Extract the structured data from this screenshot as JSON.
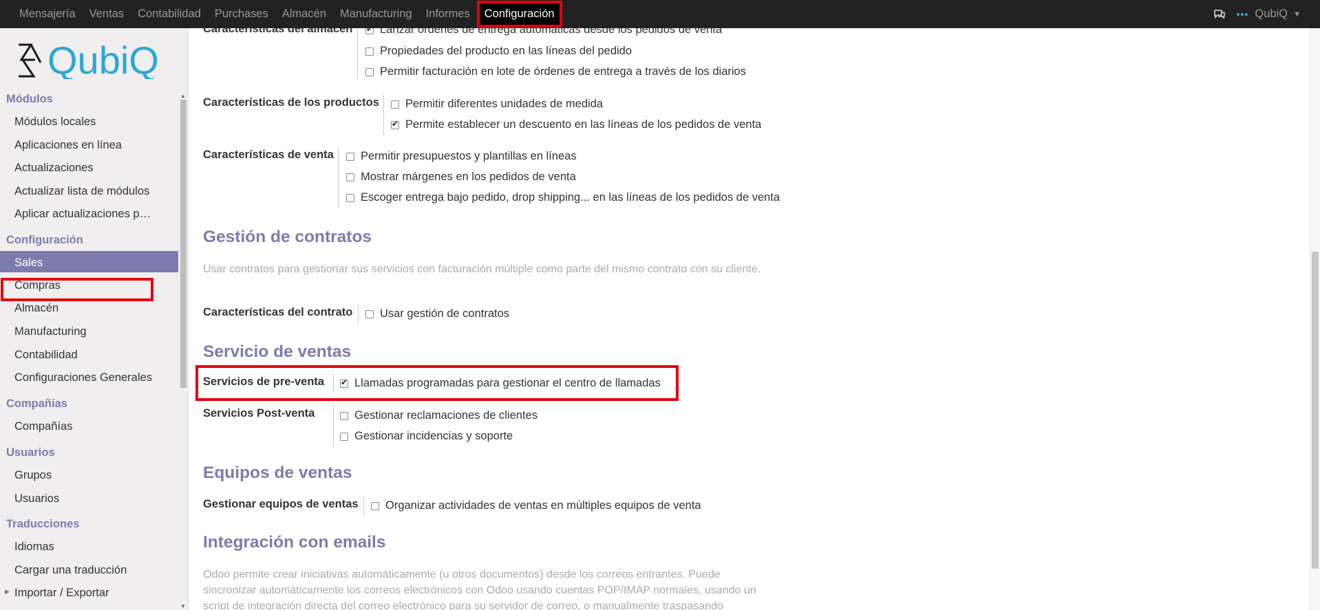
{
  "topbar": {
    "menu": [
      "Mensajería",
      "Ventas",
      "Contabilidad",
      "Purchases",
      "Almacén",
      "Manufacturing",
      "Informes",
      "Configuración"
    ],
    "active": "Configuración",
    "user": "QubiQ"
  },
  "sidebar": {
    "logo_text": "QubiQ",
    "sections": [
      {
        "title": "Módulos",
        "items": [
          "Módulos locales",
          "Aplicaciones en línea",
          "Actualizaciones",
          "Actualizar lista de módulos",
          "Aplicar actualizaciones p…"
        ]
      },
      {
        "title": "Configuración",
        "items": [
          "Sales",
          "Compras",
          "Almacén",
          "Manufacturing",
          "Contabilidad",
          "Configuraciones Generales"
        ]
      },
      {
        "title": "Compañías",
        "items": [
          "Compañías"
        ]
      },
      {
        "title": "Usuarios",
        "items": [
          "Grupos",
          "Usuarios"
        ]
      },
      {
        "title": "Traducciones",
        "items": [
          "Idiomas",
          "Cargar una traducción",
          "Importar / Exportar"
        ]
      }
    ],
    "selected": "Sales"
  },
  "main": {
    "almacen_label": "Características del almacén",
    "almacen_opts": [
      {
        "label": "Lanzar órdenes de entrega automáticas desde los pedidos de venta",
        "checked": true
      },
      {
        "label": "Propiedades del producto en las líneas del pedido",
        "checked": false
      },
      {
        "label": "Permitir facturación en lote de órdenes de entrega a través de los diarios",
        "checked": false
      }
    ],
    "productos_label": "Características de los productos",
    "productos_opts": [
      {
        "label": "Permitir diferentes unidades de medida",
        "checked": false
      },
      {
        "label": "Permite establecer un descuento en las líneas de los pedidos de venta",
        "checked": true
      }
    ],
    "venta_label": "Características de venta",
    "venta_opts": [
      {
        "label": "Permitir presupuestos y plantillas en líneas",
        "checked": false
      },
      {
        "label": "Mostrar márgenes en los pedidos de venta",
        "checked": false
      },
      {
        "label": "Escoger entrega bajo pedido, drop shipping... en las líneas de los pedidos de venta",
        "checked": false
      }
    ],
    "contratos_heading": "Gestión de contratos",
    "contratos_desc": "Usar contratos para gestionar sus servicios con facturación múltiple como parte del mismo contrato con su cliente.",
    "contrato_label": "Características del contrato",
    "contrato_opt": {
      "label": "Usar gestión de contratos",
      "checked": false
    },
    "servicio_heading": "Servicio de ventas",
    "preventa_label": "Servicios de pre-venta",
    "preventa_opt": {
      "label": "Llamadas programadas para gestionar el centro de llamadas",
      "checked": true
    },
    "postventa_label": "Servicios Post-venta",
    "postventa_opts": [
      {
        "label": "Gestionar reclamaciones de clientes",
        "checked": false
      },
      {
        "label": "Gestionar incidencias y soporte",
        "checked": false
      }
    ],
    "equipos_heading": "Equipos de ventas",
    "equipos_label": "Gestionar equipos de ventas",
    "equipos_opt": {
      "label": "Organizar actividades de ventas en múltiples equipos de venta",
      "checked": false
    },
    "emails_heading": "Integración con emails",
    "emails_desc": "Odoo permite crear iniciativas automáticamente (u otros documentos) desde los correos entrantes. Puede sincronizar automáticamente los correos electrónicos con Odoo usando cuentas POP/IMAP normales, usando un script de integración directa del correo electrónico para su servidor de correo, o manualmente traspasando"
  },
  "colors": {
    "accent": "#7c7bad",
    "highlight": "#e3000f",
    "topbar": "#222222"
  }
}
